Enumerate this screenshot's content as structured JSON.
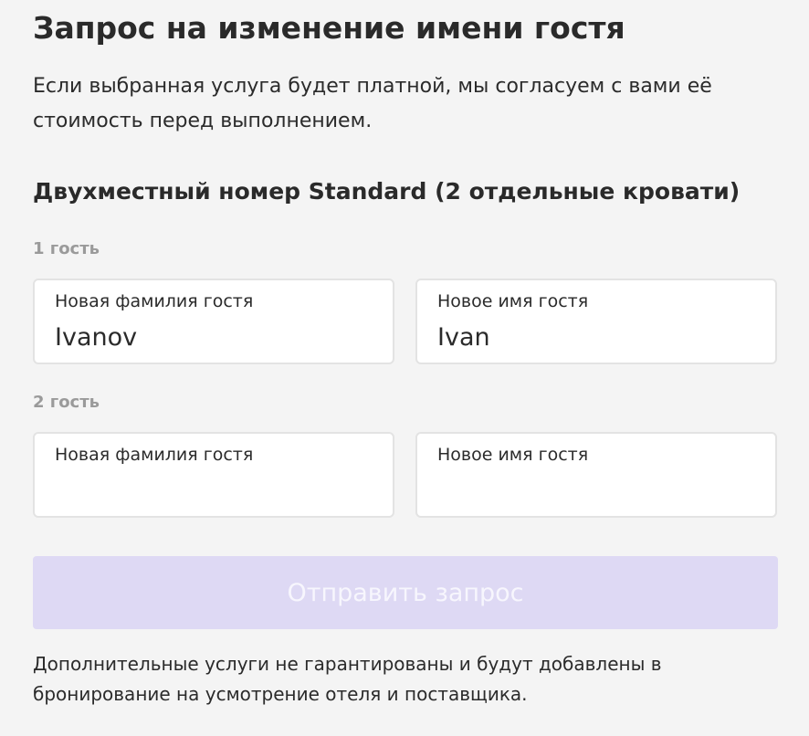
{
  "title": "Запрос на изменение имени гостя",
  "description": "Если выбранная услуга будет платной, мы согласуем с вами её стоимость перед выполнением.",
  "room_title": "Двухместный номер Standard (2 отдельные кровати)",
  "guests": [
    {
      "label": "1 гость",
      "surname_label": "Новая фамилия гостя",
      "surname_value": "Ivanov",
      "name_label": "Новое имя гостя",
      "name_value": "Ivan"
    },
    {
      "label": "2 гость",
      "surname_label": "Новая фамилия гостя",
      "surname_value": "",
      "name_label": "Новое имя гостя",
      "name_value": ""
    }
  ],
  "submit_label": "Отправить запрос",
  "footnote": "Дополнительные услуги не гарантированы и будут добавлены в бронирование на усмотрение отеля и поставщика.",
  "colors": {
    "background": "#f4f4f4",
    "submit_disabled_bg": "#ded9f4",
    "submit_disabled_text": "#f7f6fd",
    "secondary_label": "#9a9a9a"
  }
}
